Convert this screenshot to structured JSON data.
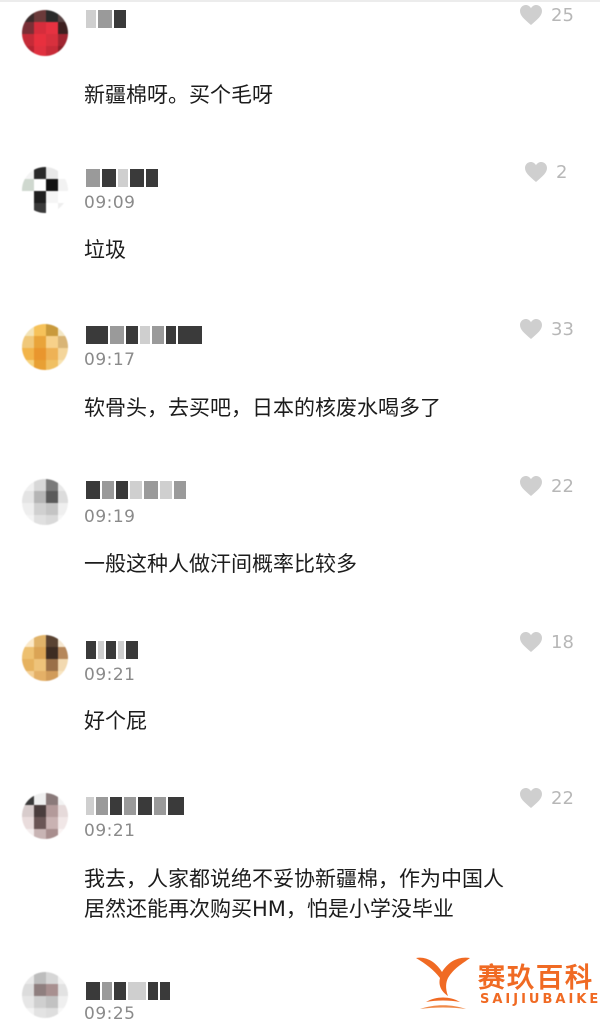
{
  "comments": [
    {
      "time": "",
      "text": "新疆棉呀。买个毛呀",
      "likes": "25"
    },
    {
      "time": "09:09",
      "text": "垃圾",
      "likes": "2"
    },
    {
      "time": "09:17",
      "text": "软骨头，去买吧，日本的核废水喝多了",
      "likes": "33"
    },
    {
      "time": "09:19",
      "text": "一般这种人做汗间概率比较多",
      "likes": "22"
    },
    {
      "time": "09:21",
      "text": "好个屁",
      "likes": "18"
    },
    {
      "time": "09:21",
      "text": "我去，人家都说绝不妥协新疆棉，作为中国人居然还能再次购买HM，怕是小学没毕业",
      "likes": "22"
    },
    {
      "time": "09:25",
      "text": "",
      "likes": ""
    }
  ],
  "watermark": {
    "title": "赛玖百科",
    "subtitle": "SAIJIUBAIKE"
  },
  "icons": {
    "like": "heart-icon",
    "logo": "whale-tail-icon"
  },
  "colors": {
    "heart": "#cfcfcf",
    "time": "#8a8a8a",
    "watermark": "#f06a23"
  }
}
